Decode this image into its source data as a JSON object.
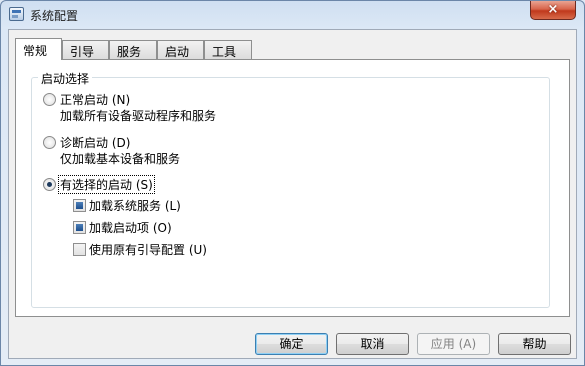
{
  "window": {
    "title": "系统配置",
    "close_glyph": "×"
  },
  "tabs": [
    {
      "label": "常规",
      "active": true
    },
    {
      "label": "引导",
      "active": false
    },
    {
      "label": "服务",
      "active": false
    },
    {
      "label": "启动",
      "active": false
    },
    {
      "label": "工具",
      "active": false
    }
  ],
  "startup": {
    "group_label": "启动选择",
    "options": [
      {
        "label": "正常启动 (N)",
        "description": "加载所有设备驱动程序和服务",
        "selected": false
      },
      {
        "label": "诊断启动 (D)",
        "description": "仅加载基本设备和服务",
        "selected": false
      },
      {
        "label": "有选择的启动 (S)",
        "description": "",
        "selected": true
      }
    ],
    "checkboxes": [
      {
        "label": "加载系统服务 (L)",
        "checked": true
      },
      {
        "label": "加载启动项 (O)",
        "checked": true
      },
      {
        "label": "使用原有引导配置 (U)",
        "checked": false
      }
    ]
  },
  "buttons": {
    "ok": "确定",
    "cancel": "取消",
    "apply": "应用 (A)",
    "help": "帮助"
  }
}
